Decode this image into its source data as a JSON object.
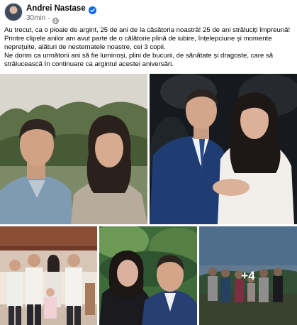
{
  "post": {
    "author": "Andrei Nastase",
    "time": "30min",
    "separator": "·",
    "lines": [
      "Au trecut, ca o ploaie de argint, 25 de ani de la căsătoria noastră! 25 de ani străluciți împreună!",
      "Printre clipele anilor am avut parte de o călătorie plină de iubire, înțelepciune și momente",
      "nepreţuite, alături de nestematele noastre, cei 3 copii.",
      "Ne dorim ca următorii ani să fie luminoși, plini de bucurii, de sănătate și dragoste, care să",
      "strălucească în continuare ca argintul acestei aniversări."
    ]
  },
  "icons": {
    "verified": "verified-badge-icon",
    "audience": "globe-icon"
  },
  "colors": {
    "verified_blue": "#0866ff",
    "secondary_text": "#65676b"
  },
  "media": {
    "more_count": "+4"
  }
}
